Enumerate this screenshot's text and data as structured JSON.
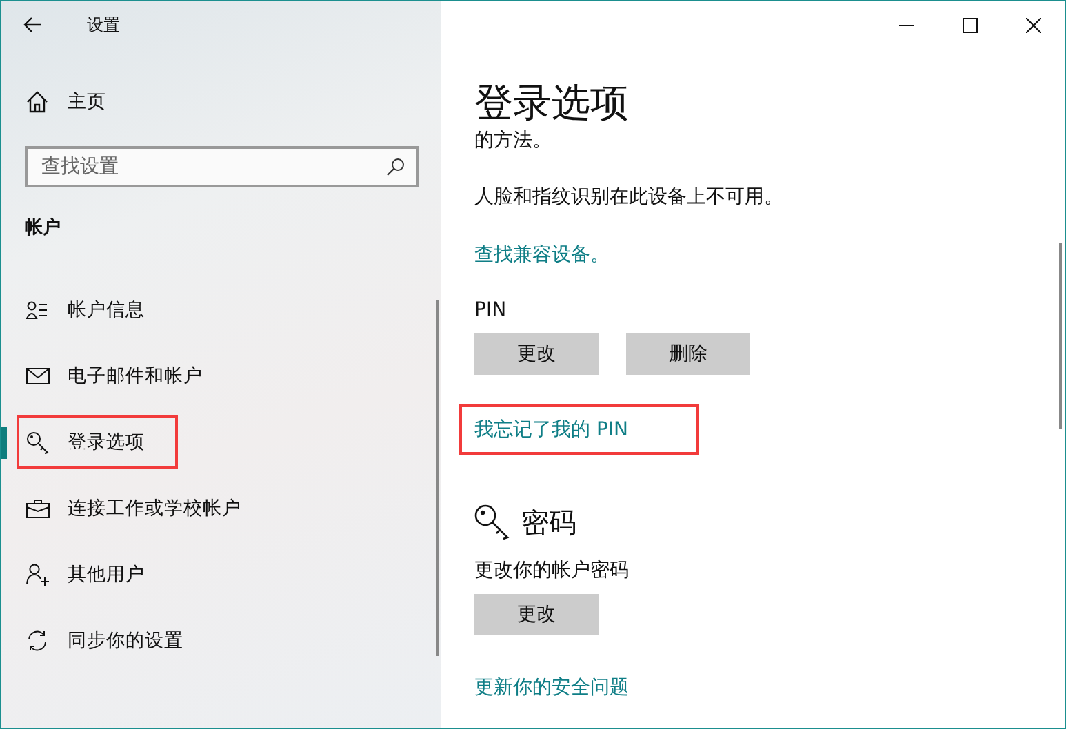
{
  "sidebar": {
    "title": "设置",
    "home": "主页",
    "search": {
      "placeholder": "查找设置"
    },
    "section": "帐户",
    "items": [
      {
        "label": "帐户信息",
        "selected": false,
        "highlighted": false
      },
      {
        "label": "电子邮件和帐户",
        "selected": false,
        "highlighted": false
      },
      {
        "label": "登录选项",
        "selected": true,
        "highlighted": true
      },
      {
        "label": "连接工作或学校帐户",
        "selected": false,
        "highlighted": false
      },
      {
        "label": "其他用户",
        "selected": false,
        "highlighted": false
      },
      {
        "label": "同步你的设置",
        "selected": false,
        "highlighted": false
      }
    ]
  },
  "content": {
    "title": "登录选项",
    "cut_text": "的方法。",
    "face_note": "人脸和指纹识别在此设备上不可用。",
    "compat_link": "查找兼容设备。",
    "pin": {
      "label": "PIN",
      "buttons": [
        "更改",
        "删除"
      ],
      "forgot_link": {
        "label": "我忘记了我的 PIN",
        "highlighted": true
      }
    },
    "password": {
      "heading": "密码",
      "description": "更改你的帐户密码",
      "button": "更改",
      "link": "更新你的安全问题"
    }
  }
}
